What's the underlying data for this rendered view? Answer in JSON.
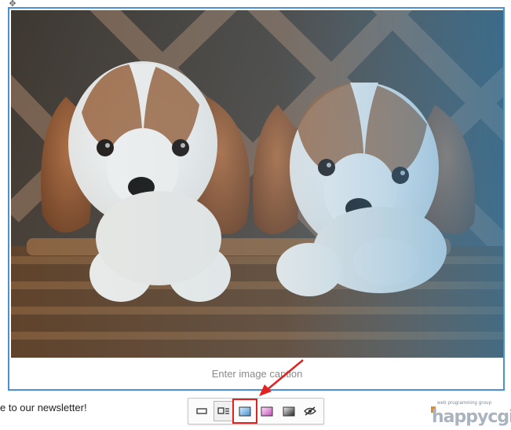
{
  "drag_handle_icon": "move-icon",
  "image": {
    "alt": "Two Cavalier King Charles Spaniel puppies in a wicker basket",
    "caption_placeholder": "Enter image caption"
  },
  "newsletter_text": "e to our newsletter!",
  "toolbar": {
    "buttons": [
      {
        "name": "full-width-icon",
        "title": "Full size image",
        "active": false
      },
      {
        "name": "side-image-icon",
        "title": "Side image",
        "active": true
      },
      {
        "name": "blue-filter-icon",
        "title": "Blue filter",
        "active": false,
        "highlighted": true
      },
      {
        "name": "pink-filter-icon",
        "title": "Pink filter",
        "active": false
      },
      {
        "name": "grayscale-filter-icon",
        "title": "Grayscale filter",
        "active": false
      },
      {
        "name": "no-filter-icon",
        "title": "No filter",
        "active": false
      }
    ]
  },
  "logo": {
    "tagline": "web programming group",
    "wordmark": "happycgi"
  },
  "colors": {
    "accent": "#4a90d9",
    "highlight": "#e32121",
    "logo_orange": "#e8892a"
  }
}
